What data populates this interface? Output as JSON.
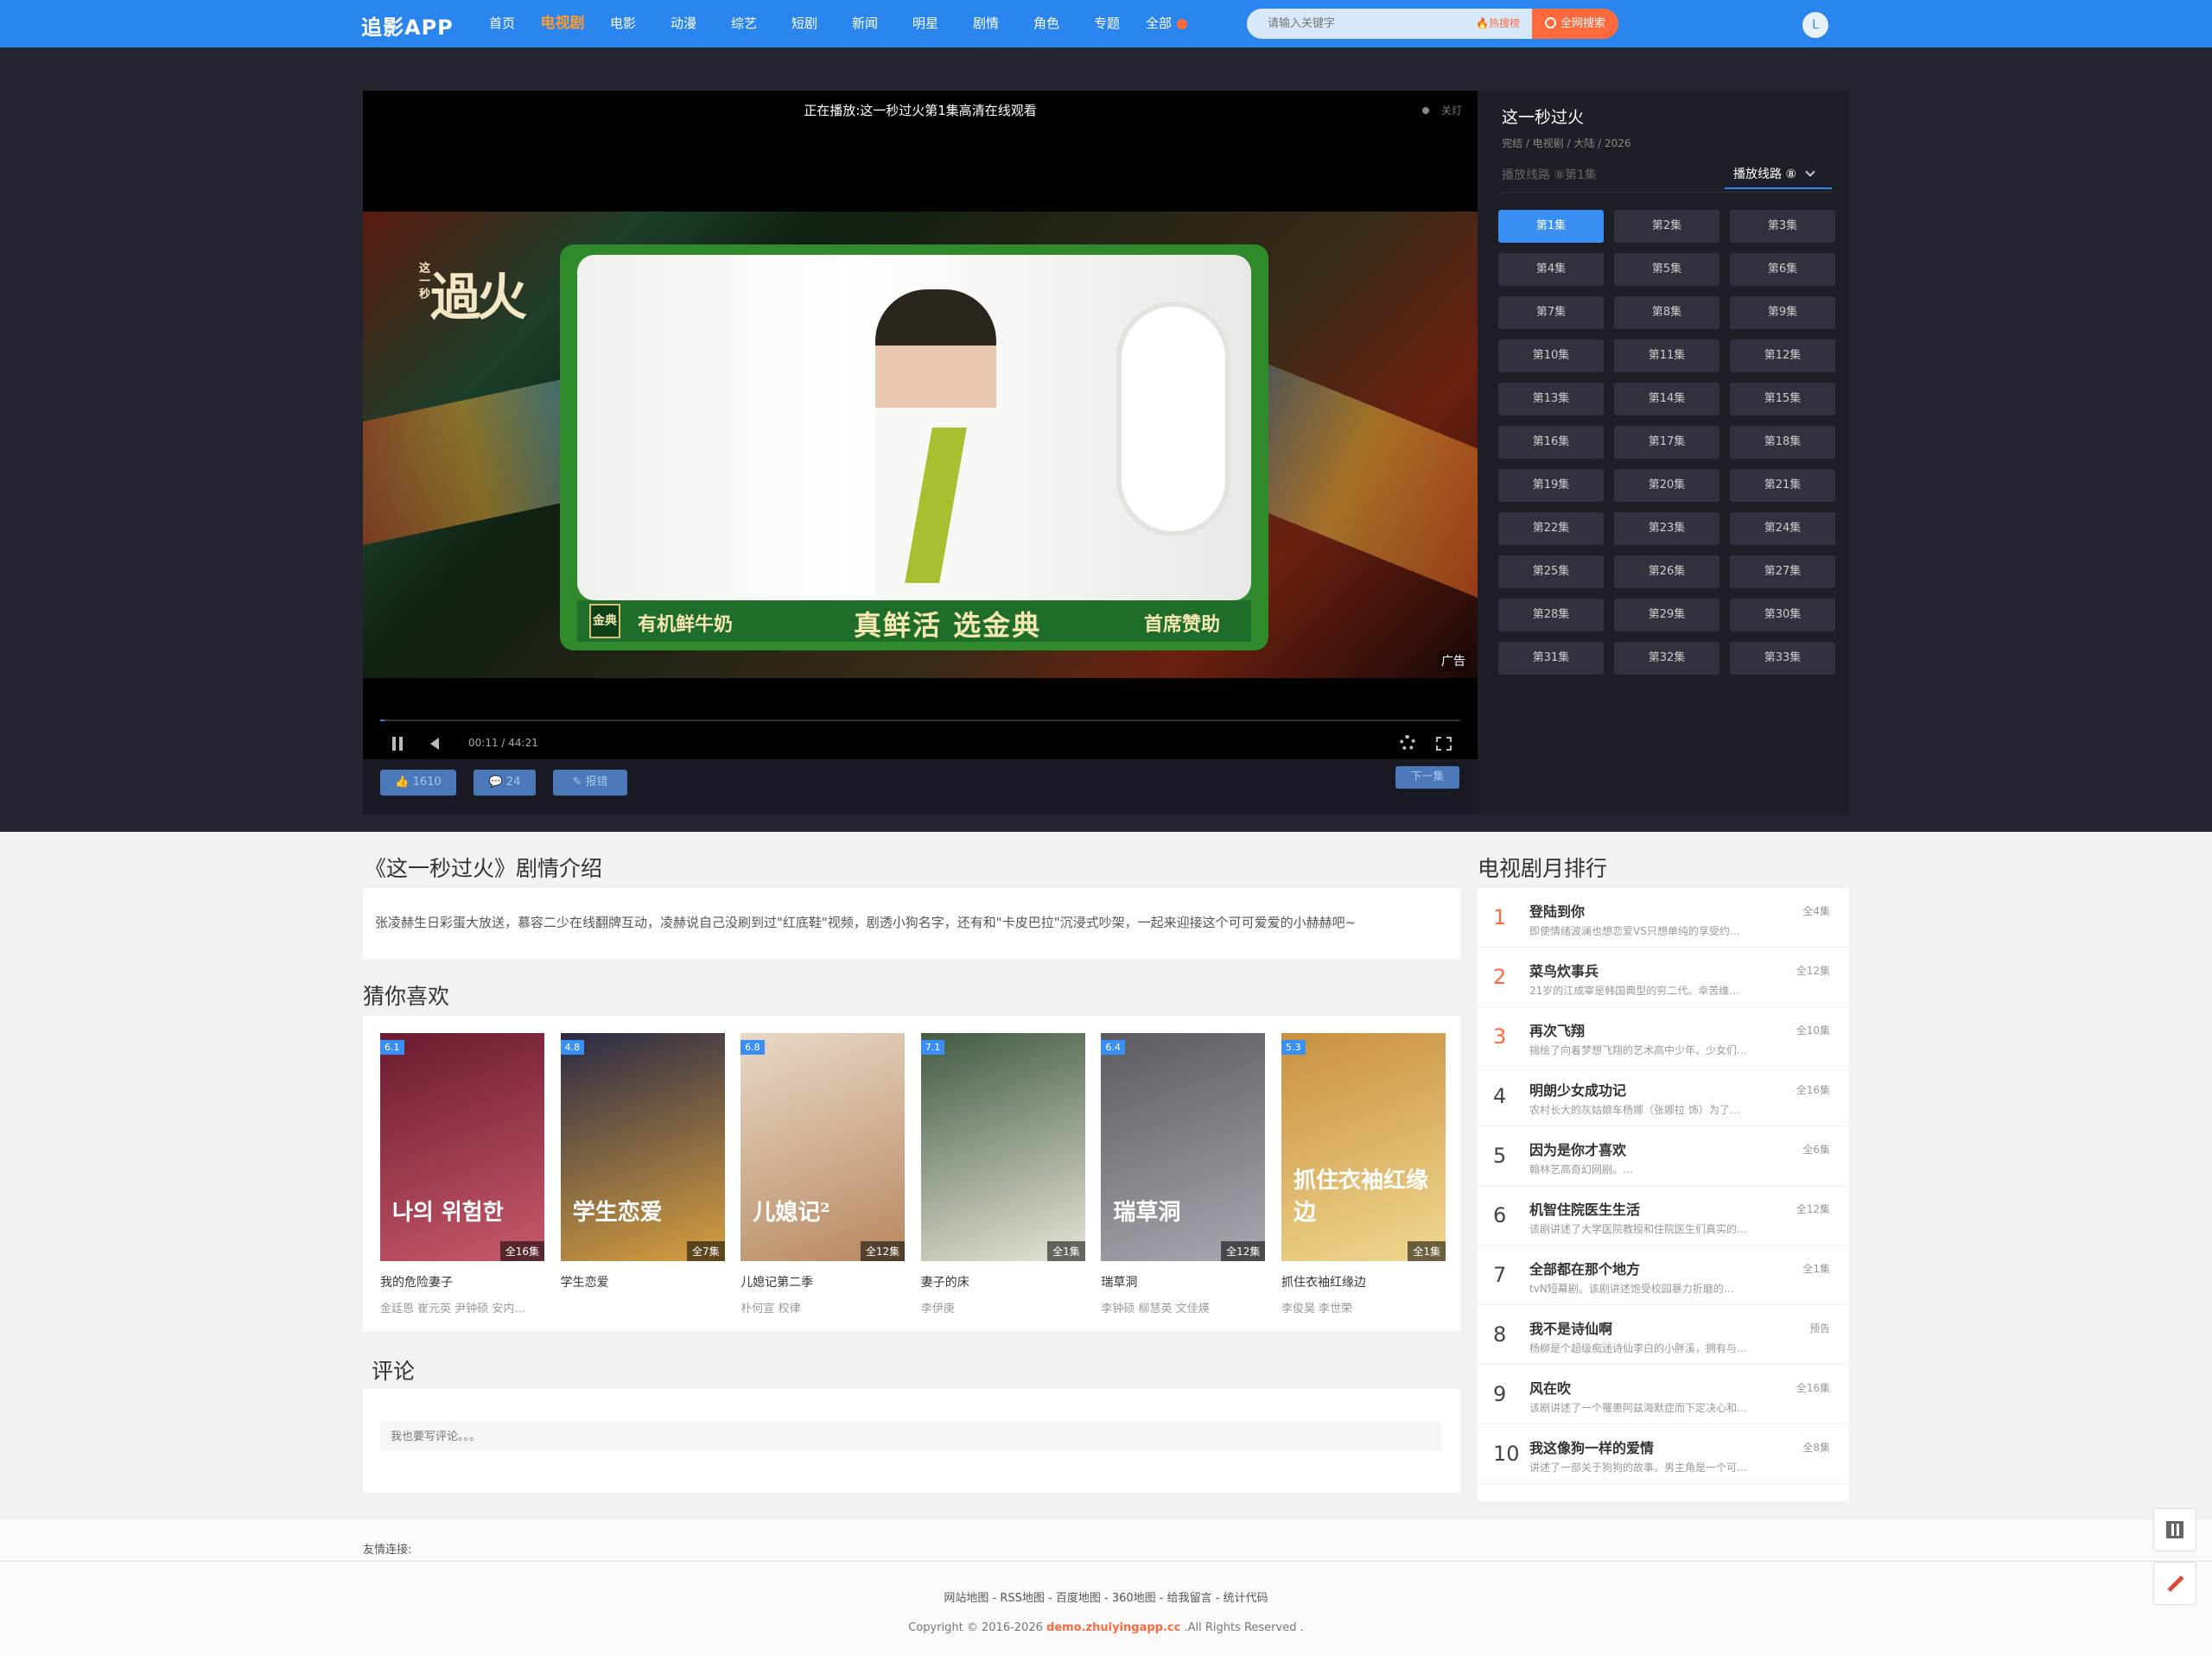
{
  "header": {
    "logo": "追影APP",
    "nav": [
      "首页",
      "电视剧",
      "电影",
      "动漫",
      "综艺",
      "短剧",
      "新闻",
      "明星",
      "剧情",
      "角色",
      "专题"
    ],
    "nav_active": "电视剧",
    "nav_more": "全部",
    "search_placeholder": "请输入关键字",
    "hot_label": "🔥热搜榜",
    "search_button": "全网搜索",
    "avatar_letter": "L"
  },
  "player": {
    "title": "正在播放:这一秒过火第1集高清在线观看",
    "light": "关灯",
    "ad_logo": "過火",
    "ad_logo_small": "这一秒",
    "banner_brand": "金典",
    "banner_left": "有机鲜牛奶",
    "banner_center": "真鲜活 选金典",
    "banner_right": "首席赞助",
    "ad_label": "广告",
    "time": "00:11 / 44:21",
    "progress_percent": 0.4,
    "like": "1610",
    "dislike": "24",
    "report": "报错",
    "next": "下一集"
  },
  "side": {
    "title": "这一秒过火",
    "meta": "完结 / 电视剧 / 大陆   / 2026",
    "line_label": "播放线路 ⑧第1集",
    "route_button": "播放线路 ⑧",
    "episodes": [
      "第1集",
      "第2集",
      "第3集",
      "第4集",
      "第5集",
      "第6集",
      "第7集",
      "第8集",
      "第9集",
      "第10集",
      "第11集",
      "第12集",
      "第13集",
      "第14集",
      "第15集",
      "第16集",
      "第17集",
      "第18集",
      "第19集",
      "第20集",
      "第21集",
      "第22集",
      "第23集",
      "第24集",
      "第25集",
      "第26集",
      "第27集",
      "第28集",
      "第29集",
      "第30集",
      "第31集",
      "第32集",
      "第33集"
    ],
    "active_episode": "第1集"
  },
  "intro": {
    "heading": "《这一秒过火》剧情介绍",
    "text": "张凌赫生日彩蛋大放送，慕容二少在线翻牌互动，凌赫说自己没刷到过\"红底鞋\"视频，剧透小狗名字，还有和\"卡皮巴拉\"沉浸式吵架，一起来迎接这个可可爱爱的小赫赫吧~"
  },
  "guess": {
    "heading": "猜你喜欢",
    "items": [
      {
        "name": "我的危险妻子",
        "cast": "金廷恩 崔元英 尹钟硕 安内…",
        "score": "6.1",
        "tag": "全16集",
        "poster_text": "나의 위험한",
        "colors": [
          "#6a1a30",
          "#c85a6a"
        ]
      },
      {
        "name": "学生恋爱",
        "cast": "",
        "score": "4.8",
        "tag": "全7集",
        "poster_text": "学生恋爱",
        "colors": [
          "#2a2a44",
          "#d8a040"
        ]
      },
      {
        "name": "儿媳记第二季",
        "cast": "朴何宣 权律",
        "score": "6.8",
        "tag": "全12集",
        "poster_text": "儿媳记²",
        "colors": [
          "#e8d8c8",
          "#b88860"
        ]
      },
      {
        "name": "妻子的床",
        "cast": "李伊庚",
        "score": "7.1",
        "tag": "全1集",
        "poster_text": "",
        "colors": [
          "#405a40",
          "#e8e4d8"
        ]
      },
      {
        "name": "瑞草洞",
        "cast": "李钟硕 柳慧英 文佳煐",
        "score": "6.4",
        "tag": "全12集",
        "poster_text": "瑞草洞",
        "colors": [
          "#5a5a60",
          "#a8a8b0"
        ]
      },
      {
        "name": "抓住衣袖红缘边",
        "cast": "李俊昊 李世荣",
        "score": "5.3",
        "tag": "全1集",
        "poster_text": "抓住衣袖红缘边",
        "colors": [
          "#c89040",
          "#f0d890"
        ]
      }
    ]
  },
  "comment": {
    "heading": "评论",
    "placeholder": "我也要写评论。。。"
  },
  "rank": {
    "heading": "电视剧月排行",
    "items": [
      {
        "no": "1",
        "name": "登陆到你",
        "desc": "即使情绪波澜也想恋爱VS只想单纯的享受约…",
        "tag": "全4集"
      },
      {
        "no": "2",
        "name": "菜鸟炊事兵",
        "desc": "21岁的江成宰是韩国典型的穷二代。幸苦维…",
        "tag": "全12集"
      },
      {
        "no": "3",
        "name": "再次飞翔",
        "desc": "揣绘了向着梦想飞翔的艺术高中少年、少女们…",
        "tag": "全10集"
      },
      {
        "no": "4",
        "name": "明朗少女成功记",
        "desc": "农村长大的灰姑娘车杨娜（张娜拉 饰）为了…",
        "tag": "全16集"
      },
      {
        "no": "5",
        "name": "因为是你才喜欢",
        "desc": "翰林艺高奇幻网剧。…",
        "tag": "全6集"
      },
      {
        "no": "6",
        "name": "机智住院医生生活",
        "desc": "该剧讲述了大学医院教授和住院医生们真实的…",
        "tag": "全12集"
      },
      {
        "no": "7",
        "name": "全部都在那个地方",
        "desc": "tvN短幕剧。该剧讲述饱受校园暴力折磨的…",
        "tag": "全1集"
      },
      {
        "no": "8",
        "name": "我不是诗仙啊",
        "desc": "杨柳是个超级痴迷诗仙李白的小胖溪，拥有与…",
        "tag": "预告"
      },
      {
        "no": "9",
        "name": "风在吹",
        "desc": "该剧讲述了一个罹患阿兹海默症而下定决心和…",
        "tag": "全16集"
      },
      {
        "no": "10",
        "name": "我这像狗一样的爱情",
        "desc": "讲述了一部关于狗狗的故事。男主角是一个可…",
        "tag": "全8集"
      }
    ]
  },
  "footer": {
    "links_label": "友情连接:",
    "nav": "网站地图  -  RSS地图  -  百度地图  -  360地图  -  给我留言  - 统计代码",
    "copy_prefix": "Copyright © 2016-2026 ",
    "copy_domain": "demo.zhuiyingapp.cc",
    "copy_suffix": " .All Rights Reserved ."
  }
}
